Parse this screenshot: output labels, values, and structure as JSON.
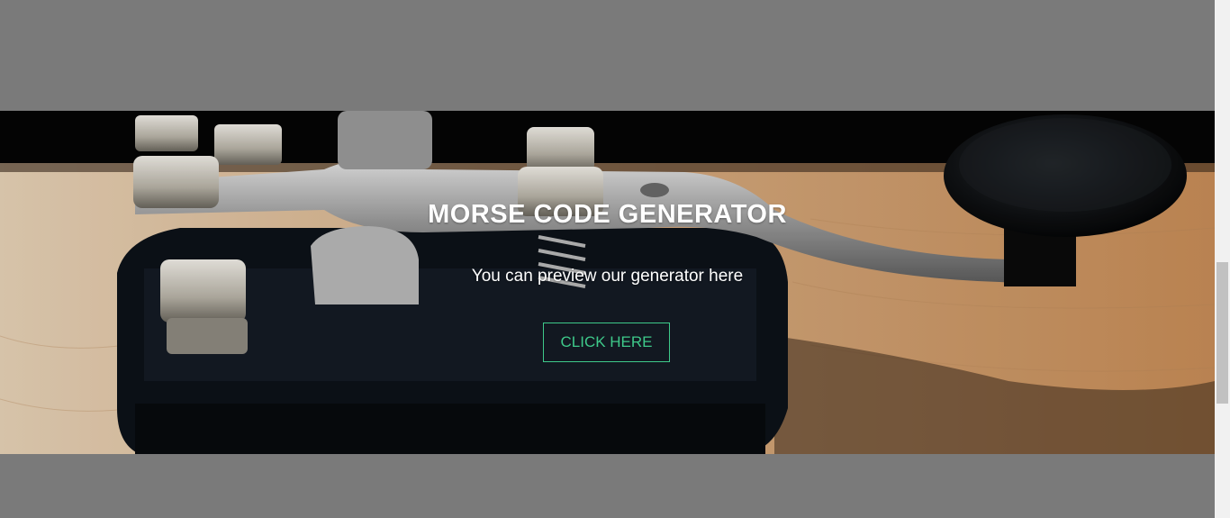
{
  "hero": {
    "title": "MORSE CODE GENERATOR",
    "subtitle": "You can preview our generator here",
    "button_label": "CLICK HERE",
    "accent_color": "#3ec98a",
    "background_image": "telegraph-key-photo"
  },
  "colors": {
    "page_background": "#7a7a7a",
    "hero_text": "#ffffff",
    "scrollbar_track": "#f1f1f1",
    "scrollbar_thumb": "#c1c1c1"
  }
}
